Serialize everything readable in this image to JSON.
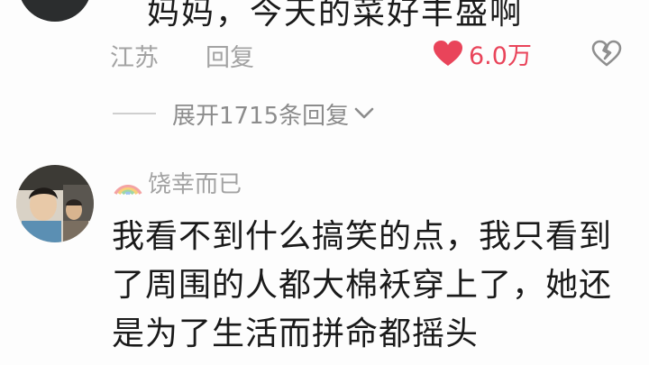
{
  "top_comment": {
    "text": "妈妈，今天的菜好丰盛啊",
    "location": "江苏",
    "reply_label": "回复",
    "like_count": "6.0万",
    "expand_replies_label": "展开1715条回复"
  },
  "second_comment": {
    "username": "饶幸而已",
    "lines": [
      "我看不到什么搞笑的点，我只看到",
      "了周围的人都大棉袄穿上了，她还",
      "是为了生活而拼命都摇头"
    ]
  },
  "colors": {
    "like_red": "#e9445a",
    "meta_gray": "#a3a3a3",
    "text_dark": "#1a1a1a"
  },
  "icons": {
    "like": "heart-icon",
    "dislike": "broken-heart-icon",
    "expand": "chevron-down-icon",
    "username_badge": "rainbow-icon"
  }
}
